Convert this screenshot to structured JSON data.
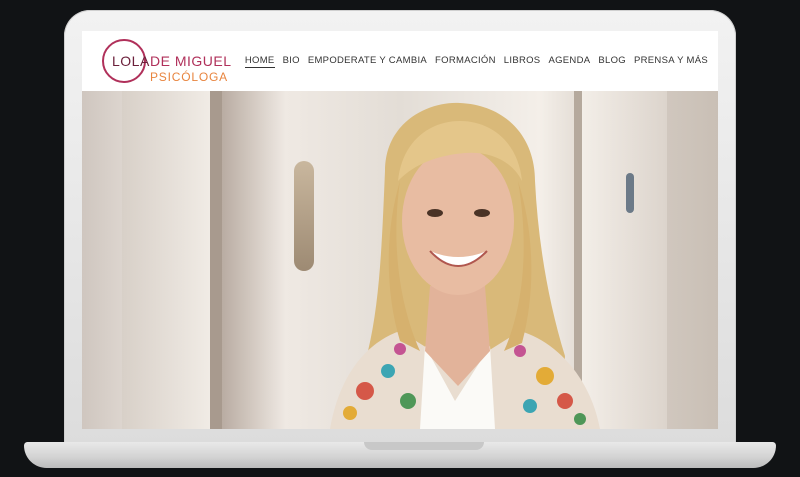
{
  "logo": {
    "first": "LOLA",
    "last": "DE MIGUEL",
    "subtitle": "PSICÓLOGA"
  },
  "nav": [
    {
      "label": "HOME",
      "active": true
    },
    {
      "label": "BIO",
      "active": false
    },
    {
      "label": "EMPODERATE Y CAMBIA",
      "active": false
    },
    {
      "label": "FORMACIÓN",
      "active": false
    },
    {
      "label": "LIBROS",
      "active": false
    },
    {
      "label": "AGENDA",
      "active": false
    },
    {
      "label": "BLOG",
      "active": false
    },
    {
      "label": "PRENSA Y MÁS",
      "active": false
    }
  ],
  "colors": {
    "brand_dark": "#6b1f3a",
    "brand": "#b0305a",
    "accent": "#e8843e"
  },
  "hero": {
    "image": "portrait-photo"
  }
}
